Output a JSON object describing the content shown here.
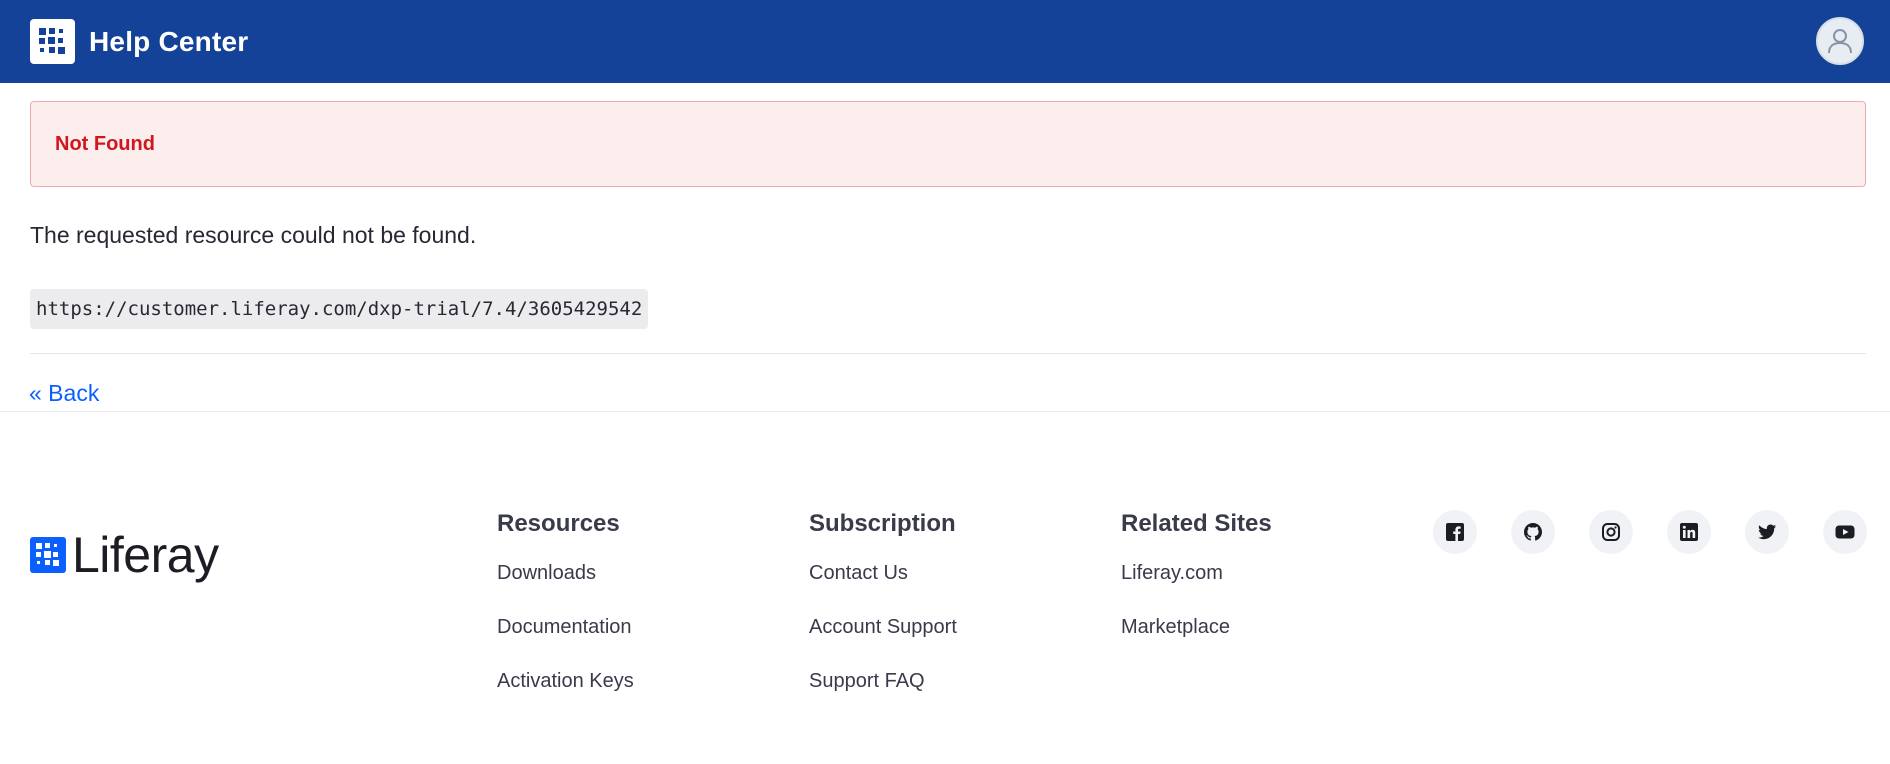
{
  "header": {
    "title": "Help Center",
    "logo_icon": "liferay-logo-icon",
    "avatar_icon": "user-avatar-icon"
  },
  "alert": {
    "title": "Not Found",
    "color": "#d2161e",
    "background": "#fdeeee"
  },
  "main": {
    "message": "The requested resource could not be found.",
    "url": "https://customer.liferay.com/dxp-trial/7.4/3605429542",
    "back_link": "« Back"
  },
  "footer": {
    "logo_text": "Liferay",
    "columns": [
      {
        "title": "Resources",
        "links": [
          "Downloads",
          "Documentation",
          "Activation Keys"
        ]
      },
      {
        "title": "Subscription",
        "links": [
          "Contact Us",
          "Account Support",
          "Support FAQ"
        ]
      },
      {
        "title": "Related Sites",
        "links": [
          "Liferay.com",
          "Marketplace"
        ]
      }
    ],
    "social_icons": [
      "facebook-icon",
      "github-icon",
      "instagram-icon",
      "linkedin-icon",
      "twitter-icon",
      "youtube-icon"
    ]
  },
  "colors": {
    "header_bg": "#134298",
    "link": "#0b5fff",
    "brand_blue": "#0b5fff"
  }
}
